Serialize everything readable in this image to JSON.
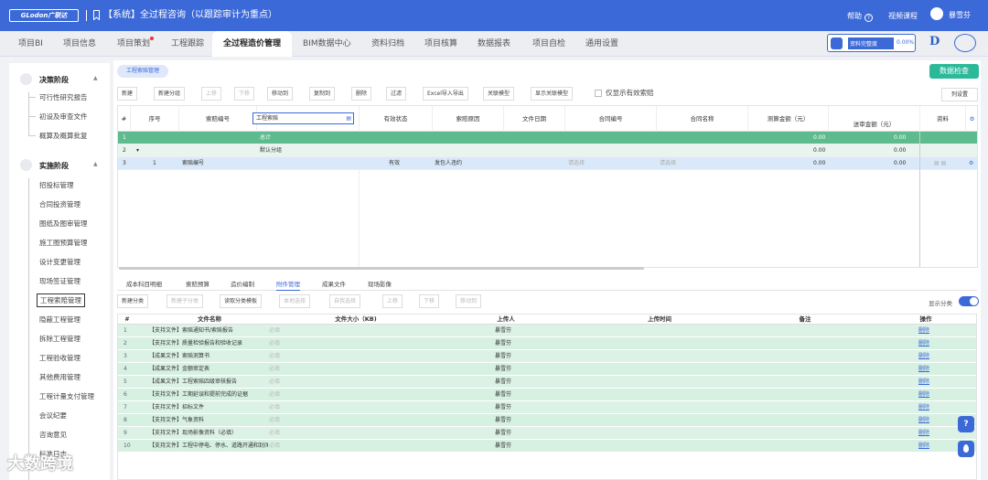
{
  "header": {
    "logo": "GLodon广联达",
    "title": "【系统】全过程咨询（以跟踪审计为重点）",
    "help": "帮助",
    "video": "视频课程",
    "username": "暴雪芬"
  },
  "nav_tabs": [
    {
      "label": "项目BI"
    },
    {
      "label": "项目信息"
    },
    {
      "label": "项目策划"
    },
    {
      "label": "工程跟踪"
    },
    {
      "label": "全过程造价管理"
    },
    {
      "label": "BIM数据中心"
    },
    {
      "label": "资料归档"
    },
    {
      "label": "项目核算"
    },
    {
      "label": "数据报表"
    },
    {
      "label": "项目自检"
    },
    {
      "label": "通用设置"
    }
  ],
  "progress": {
    "label": "资料完整度",
    "value": "0.00%",
    "fraction": 0.0
  },
  "sidebar": {
    "sections": [
      {
        "label": "决策阶段",
        "items": [
          "可行性研究报告",
          "初设及审查文件",
          "概算及概算批复"
        ]
      },
      {
        "label": "实施阶段",
        "items": [
          "招投标管理",
          "合同投资管理",
          "图纸及图审管理",
          "施工图预算管理",
          "设计变更管理",
          "现场签证管理",
          "工程索赔管理",
          "隐蔽工程管理",
          "拆除工程管理",
          "工程验收管理",
          "其他费用管理",
          "工程计量支付管理",
          "会议纪要",
          "咨询意见",
          "标准日志"
        ]
      }
    ],
    "active_item": "工程索赔管理"
  },
  "breadcrumb": "工程索赔管理",
  "check_button": "数据检查",
  "toolbar": {
    "buttons": [
      "新建",
      "新建分组",
      "上移",
      "下移",
      "移动到",
      "复制到",
      "删除",
      "过滤",
      "Excel导入导出",
      "关联模型",
      "显示关联模型"
    ],
    "checkbox_label": "仅显示有效索赔",
    "column_settings": "列设置"
  },
  "grid": {
    "headers": [
      "#",
      "序号",
      "索赔编号",
      "索赔事项",
      "有效状态",
      "索赔原因",
      "文件日期",
      "合同编号",
      "合同名称",
      "测算金额（元）",
      "送审金额（元）",
      "资料"
    ],
    "rows": [
      {
        "n": "1",
        "item": "总计",
        "amount": "0.00",
        "sent": "0.00"
      },
      {
        "n": "2",
        "item": "默认分组",
        "amount": "0.00",
        "sent": "0.00"
      },
      {
        "n": "3",
        "seq": "1",
        "code": "索赔编号",
        "item": "工程索赔",
        "status": "有效",
        "reason": "发包人违约",
        "contract_no": "请选择",
        "contract_name": "请选择",
        "amount": "0.00",
        "sent": "0.00"
      }
    ]
  },
  "lower_tabs": [
    "成本科目明细",
    "索赔预算",
    "造价编制",
    "附件管理",
    "成果文件",
    "现场影像"
  ],
  "lower_active": "附件管理",
  "toolbar2": {
    "buttons": [
      "新建分类",
      "新建子分类",
      "读取分类模板",
      "本地选择",
      "自我选择",
      "上移",
      "下移",
      "移动到"
    ],
    "toggle_label": "显示分类"
  },
  "grid2": {
    "headers": [
      "#",
      "文件名称",
      "文件大小（KB)",
      "上传人",
      "上传时间",
      "备注",
      "操作"
    ],
    "required": "必填",
    "delete": "删除",
    "rows": [
      {
        "n": "1",
        "name": "【支持文件】索赔通知书/索赔报告",
        "uploader": "暴雪芬"
      },
      {
        "n": "2",
        "name": "【支持文件】质量检验报告和验收记录",
        "uploader": "暴雪芬"
      },
      {
        "n": "3",
        "name": "【成果文件】索赔测算书",
        "uploader": "暴雪芬"
      },
      {
        "n": "4",
        "name": "【成果文件】金额审定表",
        "uploader": "暴雪芬"
      },
      {
        "n": "5",
        "name": "【成果文件】工程索赔四级审核报告",
        "uploader": "暴雪芬"
      },
      {
        "n": "6",
        "name": "【支持文件】工期延误和提前完成的证据",
        "uploader": "暴雪芬"
      },
      {
        "n": "7",
        "name": "【支持文件】招标文件",
        "uploader": "暴雪芬"
      },
      {
        "n": "8",
        "name": "【支持文件】气象资料",
        "uploader": "暴雪芬"
      },
      {
        "n": "9",
        "name": "【支持文件】现场影像资料（必填）",
        "uploader": "暴雪芬"
      },
      {
        "n": "10",
        "name": "【支持文件】工程中停电、停水、道路开通和封闭",
        "uploader": "暴雪芬"
      }
    ]
  },
  "watermark": "大数跨境",
  "colors": {
    "primary": "#3c69d8",
    "green": "#2cb99a",
    "row_green": "#d6f0e2",
    "total_green": "#5dbb8e"
  }
}
